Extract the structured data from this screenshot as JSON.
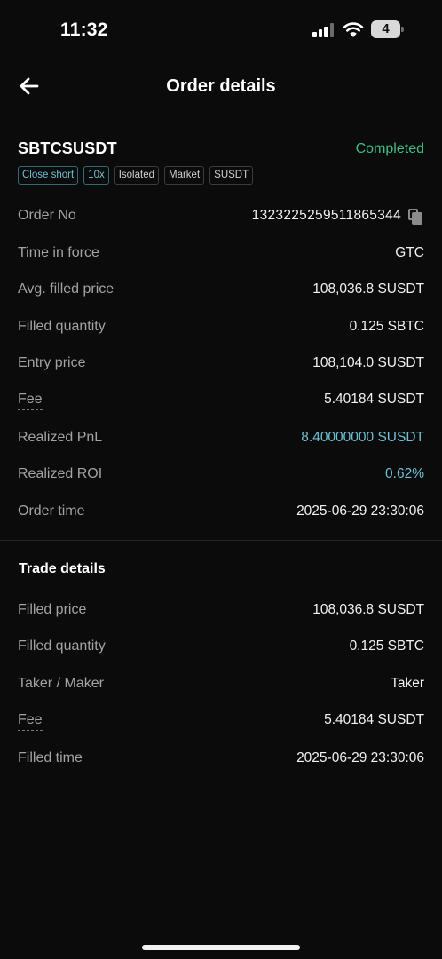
{
  "status_bar": {
    "time": "11:32",
    "battery_level": "4",
    "signal_bars_filled": 3,
    "icons": [
      "signal-icon",
      "wifi-icon",
      "battery-icon"
    ]
  },
  "header": {
    "title": "Order details",
    "back_icon": "arrow-left-icon"
  },
  "summary": {
    "symbol": "SBTCSUSDT",
    "status": "Completed",
    "status_color": "#3fbf88",
    "tags": [
      {
        "label": "Close short",
        "accent": true
      },
      {
        "label": "10x",
        "accent": true
      },
      {
        "label": "Isolated",
        "accent": false
      },
      {
        "label": "Market",
        "accent": false
      },
      {
        "label": "SUSDT",
        "accent": false
      }
    ]
  },
  "order": {
    "order_no": {
      "label": "Order No",
      "value": "1323225259511865344",
      "icon": "copy-icon"
    },
    "time_in_force": {
      "label": "Time in force",
      "value": "GTC"
    },
    "avg_filled_price": {
      "label": "Avg. filled price",
      "value": "108,036.8 SUSDT"
    },
    "filled_quantity": {
      "label": "Filled quantity",
      "value": "0.125 SBTC"
    },
    "entry_price": {
      "label": "Entry price",
      "value": "108,104.0 SUSDT"
    },
    "fee": {
      "label": "Fee",
      "value": "5.40184 SUSDT"
    },
    "realized_pnl": {
      "label": "Realized PnL",
      "value": "8.40000000 SUSDT"
    },
    "realized_roi": {
      "label": "Realized ROI",
      "value": "0.62%"
    },
    "order_time": {
      "label": "Order time",
      "value": "2025-06-29 23:30:06"
    }
  },
  "trade_details": {
    "title": "Trade details",
    "filled_price": {
      "label": "Filled price",
      "value": "108,036.8 SUSDT"
    },
    "filled_quantity": {
      "label": "Filled quantity",
      "value": "0.125 SBTC"
    },
    "taker_maker": {
      "label": "Taker / Maker",
      "value": "Taker"
    },
    "fee": {
      "label": "Fee",
      "value": "5.40184 SUSDT"
    },
    "filled_time": {
      "label": "Filled time",
      "value": "2025-06-29 23:30:06"
    }
  },
  "colors": {
    "background": "#0b0b0b",
    "positive": "#3fbf88",
    "accent_blue": "#6fc0d3"
  }
}
